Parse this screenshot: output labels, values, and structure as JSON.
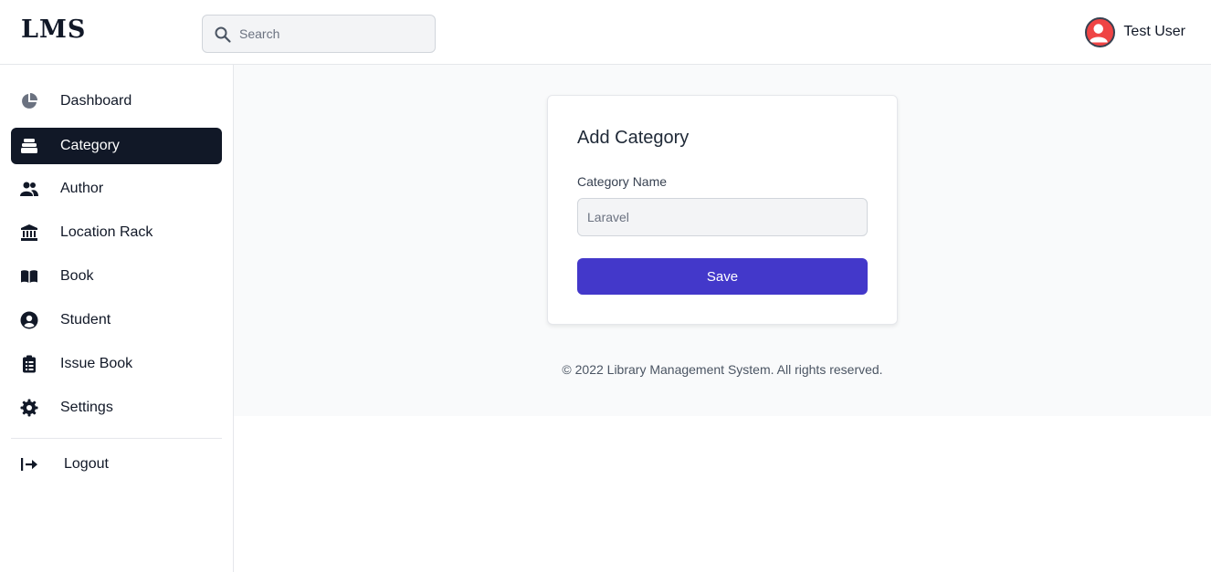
{
  "header": {
    "logo": "LMS",
    "search": {
      "placeholder": "Search",
      "icon": "search-icon"
    },
    "user": {
      "name": "Test User",
      "avatar_color": "#ef4444"
    }
  },
  "sidebar": {
    "items": [
      {
        "label": "Dashboard",
        "icon": "pie-chart-icon",
        "active": false
      },
      {
        "label": "Category",
        "icon": "stack-icon",
        "active": true
      },
      {
        "label": "Author",
        "icon": "users-icon",
        "active": false
      },
      {
        "label": "Location Rack",
        "icon": "bank-icon",
        "active": false
      },
      {
        "label": "Book",
        "icon": "book-open-icon",
        "active": false
      },
      {
        "label": "Student",
        "icon": "user-circle-icon",
        "active": false
      },
      {
        "label": "Issue Book",
        "icon": "clipboard-list-icon",
        "active": false
      },
      {
        "label": "Settings",
        "icon": "gear-icon",
        "active": false
      }
    ],
    "logout": {
      "label": "Logout",
      "icon": "logout-icon"
    }
  },
  "main": {
    "card": {
      "title": "Add Category",
      "field_label": "Category Name",
      "field_placeholder": "Laravel",
      "field_value": "",
      "save_label": "Save"
    },
    "footer": "© 2022 Library Management System. All rights reserved."
  },
  "colors": {
    "active_nav_bg": "#111827",
    "primary_button": "#4338ca",
    "content_bg": "#f9fafb"
  }
}
